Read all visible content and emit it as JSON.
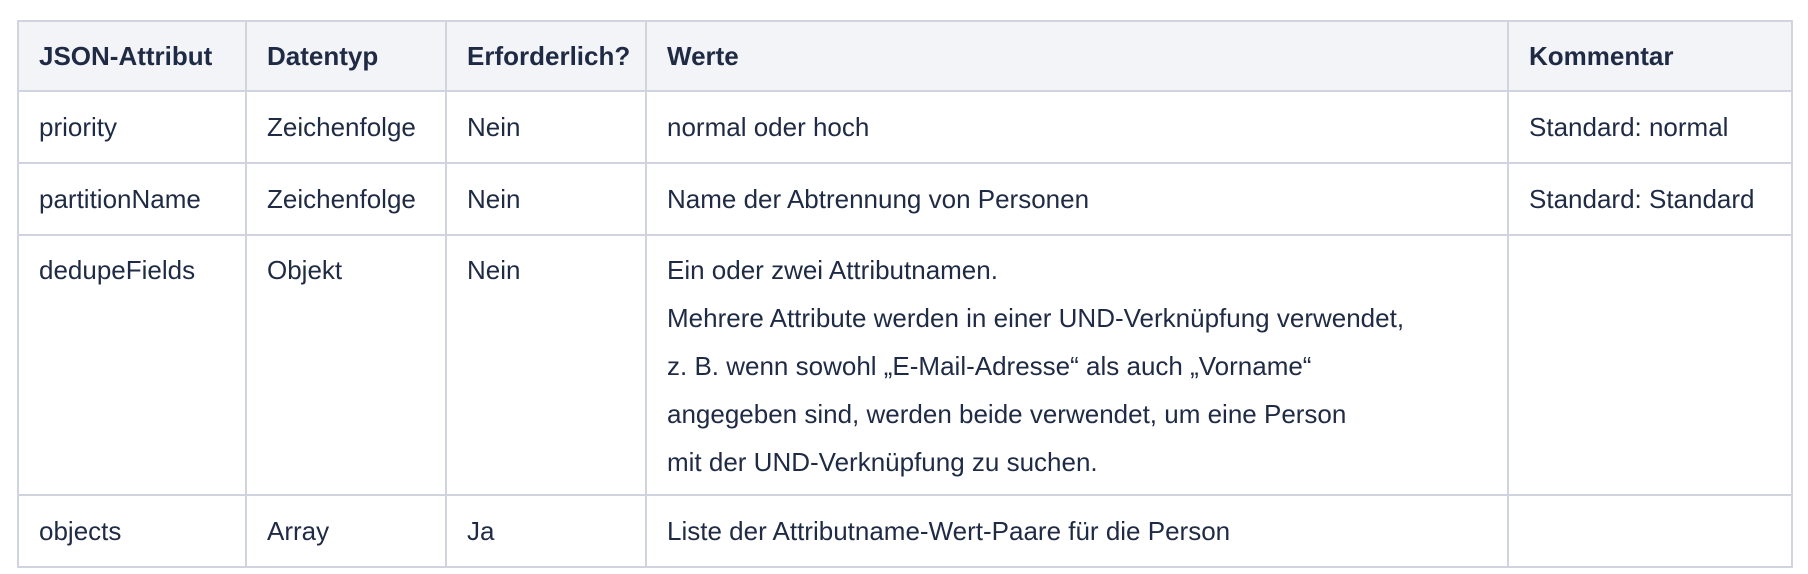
{
  "table": {
    "headers": [
      "JSON-Attribut",
      "Datentyp",
      "Erforderlich?",
      "Werte",
      "Kommentar"
    ],
    "rows": [
      {
        "attribute": "priority",
        "type": "Zeichenfolge",
        "required": "Nein",
        "values": [
          "normal oder hoch"
        ],
        "comment": "Standard: normal"
      },
      {
        "attribute": "partitionName",
        "type": "Zeichenfolge",
        "required": "Nein",
        "values": [
          "Name der Abtrennung von Personen"
        ],
        "comment": "Standard: Standard"
      },
      {
        "attribute": "dedupeFields",
        "type": "Objekt",
        "required": "Nein",
        "values": [
          "Ein oder zwei Attributnamen.",
          "Mehrere Attribute werden in einer UND-Verknüpfung verwendet,",
          "z. B. wenn sowohl „E-Mail-Adresse“ als auch „Vorname“",
          "angegeben sind, werden beide verwendet, um eine Person",
          "mit der UND-Verknüpfung zu suchen."
        ],
        "comment": ""
      },
      {
        "attribute": "objects",
        "type": "Array",
        "required": "Ja",
        "values": [
          "Liste der Attributname-Wert-Paare für die Person"
        ],
        "comment": ""
      }
    ]
  }
}
